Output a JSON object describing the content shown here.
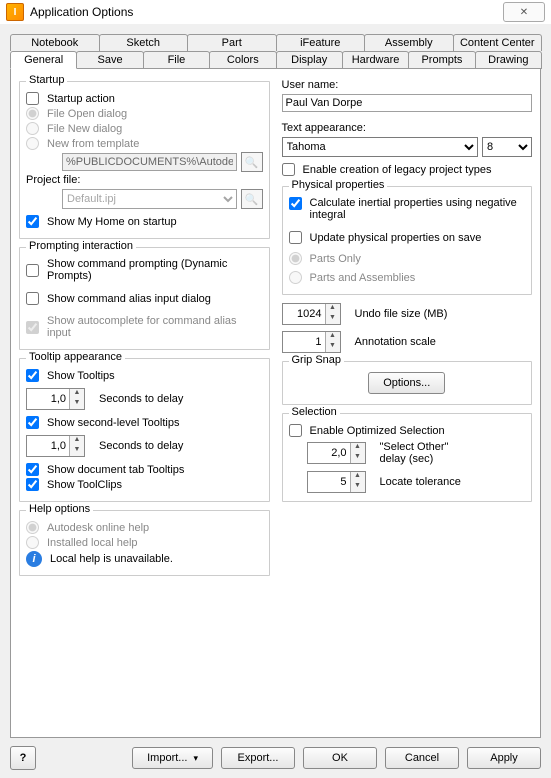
{
  "window": {
    "title": "Application Options"
  },
  "tabs": {
    "row1": [
      "Notebook",
      "Sketch",
      "Part",
      "iFeature",
      "Assembly",
      "Content Center"
    ],
    "row2": [
      "General",
      "Save",
      "File",
      "Colors",
      "Display",
      "Hardware",
      "Prompts",
      "Drawing"
    ],
    "active": "General"
  },
  "left": {
    "startup": {
      "legend": "Startup",
      "startup_action": "Startup action",
      "file_open": "File Open dialog",
      "file_new": "File New dialog",
      "new_tpl": "New from template",
      "tpl_value": "%PUBLICDOCUMENTS%\\Autodesk\\Inv",
      "proj_label": "Project file:",
      "proj_value": "Default.ipj",
      "show_home": "Show My Home on startup"
    },
    "prompting": {
      "legend": "Prompting interaction",
      "cmd_prompt": "Show command prompting (Dynamic Prompts)",
      "alias": "Show command alias input dialog",
      "autocomplete": "Show autocomplete for command alias input"
    },
    "tooltip": {
      "legend": "Tooltip appearance",
      "show_tips": "Show Tooltips",
      "delay1_val": "1,0",
      "delay_lbl": "Seconds to delay",
      "second_level": "Show second-level Tooltips",
      "delay2_val": "1,0",
      "doc_tab": "Show document tab Tooltips",
      "toolclips": "Show ToolClips"
    },
    "help": {
      "legend": "Help options",
      "online": "Autodesk online help",
      "local": "Installed local help",
      "unavail": "Local help is unavailable."
    }
  },
  "right": {
    "user_label": "User name:",
    "user_value": "Paul Van Dorpe",
    "text_app_label": "Text appearance:",
    "font_value": "Tahoma",
    "size_value": "8",
    "legacy": "Enable creation of legacy project types",
    "phys": {
      "legend": "Physical properties",
      "calc": "Calculate inertial properties using negative integral",
      "update": "Update physical properties on save",
      "parts_only": "Parts Only",
      "parts_asm": "Parts and Assemblies"
    },
    "undo_val": "1024",
    "undo_lbl": "Undo file size (MB)",
    "anno_val": "1",
    "anno_lbl": "Annotation scale",
    "grip": {
      "legend": "Grip Snap",
      "options": "Options..."
    },
    "sel": {
      "legend": "Selection",
      "optimized": "Enable Optimized Selection",
      "other_val": "2,0",
      "other_lbl1": "\"Select Other\"",
      "other_lbl2": "delay (sec)",
      "locate_val": "5",
      "locate_lbl": "Locate tolerance"
    }
  },
  "footer": {
    "import": "Import...",
    "export": "Export...",
    "ok": "OK",
    "cancel": "Cancel",
    "apply": "Apply"
  }
}
